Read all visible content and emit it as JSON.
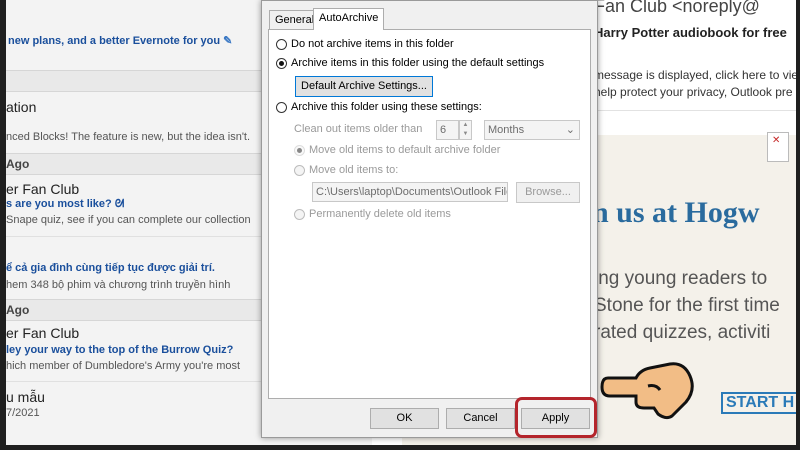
{
  "maillist": {
    "top_banner": "new plans, and a better Evernote for you",
    "item1_title": "ation",
    "item1_preview": "nced Blocks! The feature is new, but the idea isn't.",
    "header1": "Ago",
    "item2_sender": "er Fan Club",
    "item2_subject": "s are you most like?",
    "item2_preview": "Snape quiz, see if you can complete our collection",
    "item3_subject": "ể cả gia đình cùng tiếp tục được giải trí.",
    "item3_preview": "hem 348 bộ phim và chương trình truyền hình",
    "header2": "Ago",
    "item4_sender": "er Fan Club",
    "item4_subject": "ley your way to the top of the Burrow Quiz?",
    "item4_preview": "hich member of Dumbledore's Army you're most",
    "item5_sender": "u mẫu",
    "item5_date": "7/2021"
  },
  "reading": {
    "from": "Fan Club <noreply@",
    "subject": "Harry Potter audiobook for free",
    "info1": "message is displayed, click here to vie",
    "info2": "help protect your privacy, Outlook pre",
    "headline": "n us at Hogw",
    "body1": "ing young readers to",
    "body2": "Stone for the first time",
    "body3": "rated quizzes, activiti",
    "cta": "START H"
  },
  "dialog": {
    "tabs": [
      "General",
      "AutoArchive"
    ],
    "options": {
      "no_archive": "Do not archive items in this folder",
      "default_archive": "Archive items in this folder using the default settings",
      "default_settings_button": "Default Archive Settings...",
      "custom_archive": "Archive this folder using these settings:",
      "clean_out_label": "Clean out items older than",
      "clean_out_value": "6",
      "clean_out_unit": "Months",
      "move_default": "Move old items to default archive folder",
      "move_to": "Move old items to:",
      "path": "C:\\Users\\laptop\\Documents\\Outlook Files",
      "browse": "Browse...",
      "delete": "Permanently delete old items"
    },
    "buttons": {
      "ok": "OK",
      "cancel": "Cancel",
      "apply": "Apply"
    }
  }
}
